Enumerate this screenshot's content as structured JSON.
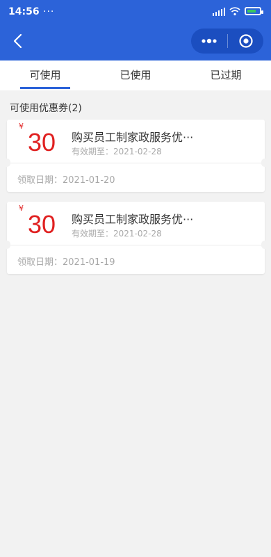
{
  "status_bar": {
    "time": "14:56",
    "dots": "···"
  },
  "header": {
    "bg_color": "#2c63d9"
  },
  "tabs": [
    {
      "label": "可使用",
      "active": true
    },
    {
      "label": "已使用",
      "active": false
    },
    {
      "label": "已过期",
      "active": false
    }
  ],
  "section": {
    "title": "可使用优惠券(2)"
  },
  "coupons": [
    {
      "currency": "¥",
      "amount": "30",
      "title": "购买员工制家政服务优···",
      "valid_until": "有效期至：2021-02-28",
      "received": "领取日期：2021-01-20"
    },
    {
      "currency": "¥",
      "amount": "30",
      "title": "购买员工制家政服务优···",
      "valid_until": "有效期至：2021-02-28",
      "received": "领取日期：2021-01-19"
    }
  ],
  "colors": {
    "accent": "#2c63d9",
    "price": "#e02020",
    "muted": "#a8a8a8"
  }
}
